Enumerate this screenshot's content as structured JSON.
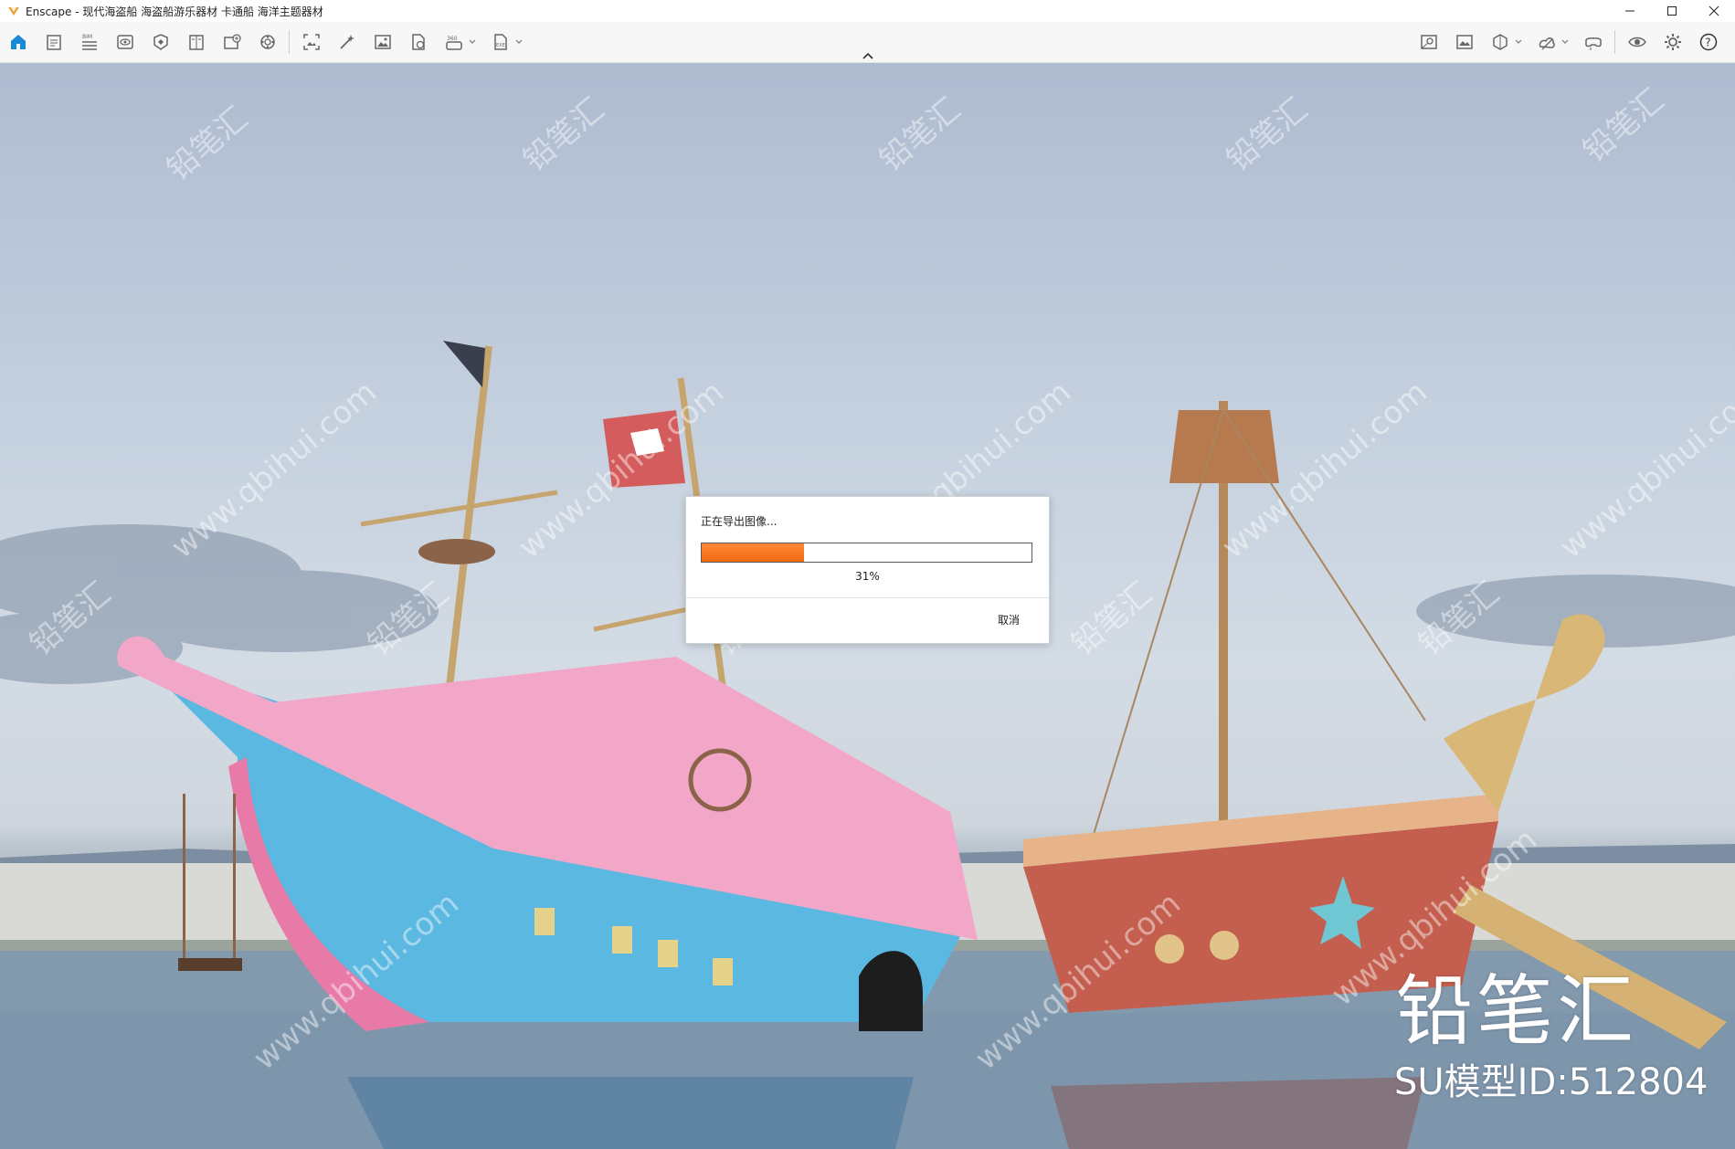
{
  "window": {
    "title": "Enscape - 现代海盗船 海盗船游乐器材 卡通船 海洋主题器材",
    "controls": [
      "minimize-icon",
      "maximize-icon",
      "close-icon"
    ]
  },
  "toolbar": {
    "left_icons": [
      "home-icon",
      "notes-icon",
      "bim-icon",
      "view-icon",
      "asset-library-icon",
      "book-icon",
      "capture-icon",
      "settings-wheel-icon",
      "screenshot-icon",
      "batch-render-icon",
      "image-icon",
      "doc-export-icon",
      "panorama-360-icon",
      "exe-export-icon"
    ],
    "right_icons": [
      "map-icon",
      "image-settings-icon",
      "cube-icon",
      "cloud-upload-icon",
      "vr-headset-icon",
      "visual-settings-icon",
      "gear-icon",
      "help-icon"
    ]
  },
  "dialog": {
    "title": "正在导出图像...",
    "progress_percent": 31,
    "progress_text": "31%",
    "cancel_label": "取消"
  },
  "watermark": {
    "brand": "铅笔汇",
    "model_id": "SU模型ID:512804",
    "repeated": [
      "铅笔汇",
      "www.qbihui.com"
    ]
  },
  "colors": {
    "progress_fill": "#f06a10",
    "home_icon": "#1a8ad4"
  }
}
